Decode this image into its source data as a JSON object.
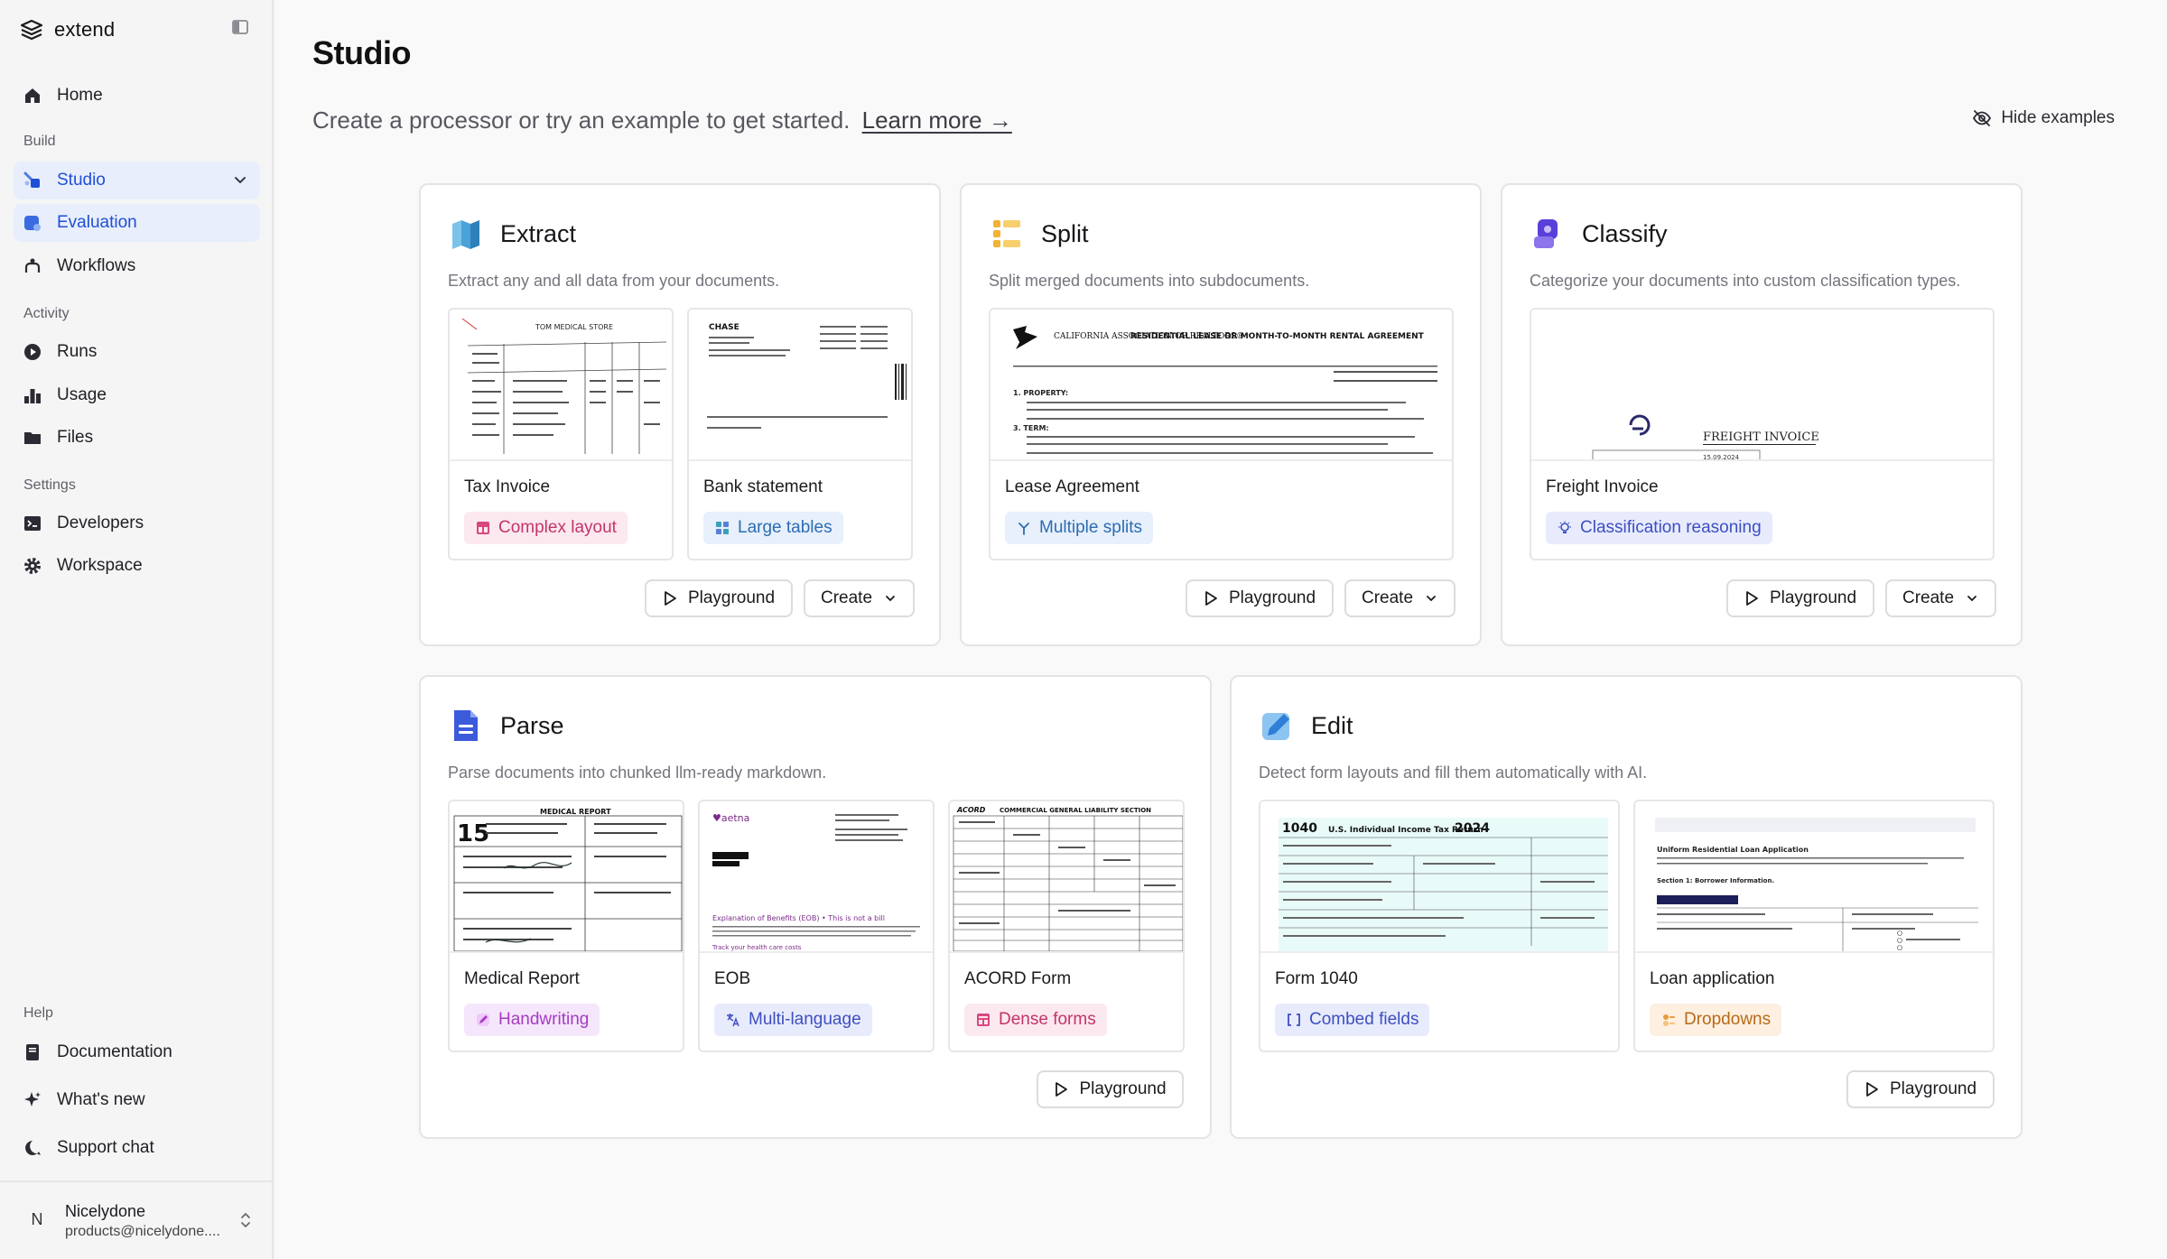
{
  "brand": {
    "name": "extend"
  },
  "sidebar": {
    "home": "Home",
    "sections": {
      "build": "Build",
      "activity": "Activity",
      "settings": "Settings",
      "help": "Help"
    },
    "build_items": [
      "Studio",
      "Evaluation",
      "Workflows"
    ],
    "activity_items": [
      "Runs",
      "Usage",
      "Files"
    ],
    "settings_items": [
      "Developers",
      "Workspace"
    ],
    "help_items": [
      "Documentation",
      "What's new",
      "Support chat"
    ],
    "active_item": "Studio",
    "user": {
      "initial": "N",
      "name": "Nicelydone",
      "email": "products@nicelydone...."
    }
  },
  "page": {
    "title": "Studio",
    "subtitle": "Create a processor or try an example to get started.",
    "learn_more": "Learn more →",
    "hide_examples": "Hide examples"
  },
  "buttons": {
    "playground": "Playground",
    "create": "Create"
  },
  "cards": {
    "extract": {
      "title": "Extract",
      "desc": "Extract any and all data from your documents.",
      "examples": [
        {
          "name": "Tax Invoice",
          "tag": "Complex layout"
        },
        {
          "name": "Bank statement",
          "tag": "Large tables"
        }
      ]
    },
    "split": {
      "title": "Split",
      "desc": "Split merged documents into subdocuments.",
      "examples": [
        {
          "name": "Lease Agreement",
          "tag": "Multiple splits"
        }
      ]
    },
    "classify": {
      "title": "Classify",
      "desc": "Categorize your documents into custom classification types.",
      "examples": [
        {
          "name": "Freight Invoice",
          "tag": "Classification reasoning"
        }
      ]
    },
    "parse": {
      "title": "Parse",
      "desc": "Parse documents into chunked llm-ready markdown.",
      "examples": [
        {
          "name": "Medical Report",
          "tag": "Handwriting"
        },
        {
          "name": "EOB",
          "tag": "Multi-language"
        },
        {
          "name": "ACORD Form",
          "tag": "Dense forms"
        }
      ]
    },
    "edit": {
      "title": "Edit",
      "desc": "Detect form layouts and fill them automatically with AI.",
      "examples": [
        {
          "name": "Form 1040",
          "tag": "Combed fields"
        },
        {
          "name": "Loan application",
          "tag": "Dropdowns"
        }
      ]
    }
  },
  "thumb_text": {
    "tax_invoice_head": "TOM MEDICAL STORE",
    "bank_brand": "CHASE",
    "lease_org": "CALIFORNIA ASSOCIATION OF REALTORS®",
    "lease_title": "RESIDENTIAL LEASE OR MONTH-TO-MONTH RENTAL AGREEMENT",
    "lease_property": "1. PROPERTY:",
    "lease_term": "3. TERM:",
    "freight_title": "FREIGHT INVOICE",
    "freight_date": "15.09.2024",
    "medical_title": "MEDICAL REPORT",
    "medical_num": "15",
    "eob_brand": "♥aetna",
    "eob_heading": "Explanation of Benefits (EOB) • This is not a bill",
    "eob_track": "Track your health care costs",
    "acord_brand": "ACORD",
    "acord_title": "COMMERCIAL GENERAL LIABILITY SECTION",
    "f1040_num": "1040",
    "f1040_title": "U.S. Individual Income Tax Return",
    "f1040_year": "2024",
    "loan_title": "Uniform Residential Loan Application",
    "loan_section": "Section 1: Borrower Information."
  },
  "colors": {
    "accent": "#1f4fd6",
    "active_bg": "#e8eefb",
    "extract_icon": "#4aa3d8",
    "split_icon": "#f2b233",
    "classify_icon": "#5b3fd9",
    "parse_icon": "#3b5bdb",
    "edit_icon": "#3f8fe0"
  }
}
